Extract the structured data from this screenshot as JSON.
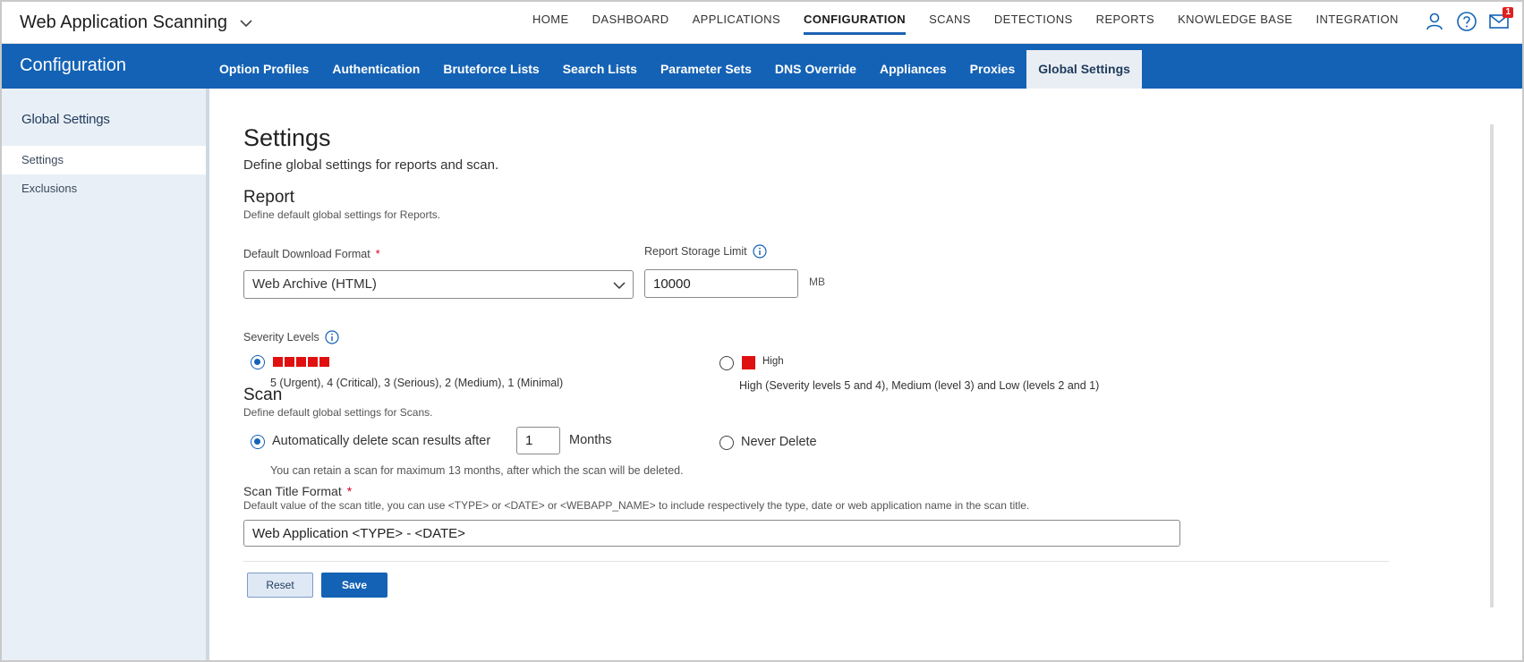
{
  "app": {
    "title": "Web Application Scanning"
  },
  "topnav": {
    "items": [
      {
        "label": "HOME"
      },
      {
        "label": "DASHBOARD"
      },
      {
        "label": "APPLICATIONS"
      },
      {
        "label": "CONFIGURATION",
        "active": true
      },
      {
        "label": "SCANS"
      },
      {
        "label": "DETECTIONS"
      },
      {
        "label": "REPORTS"
      },
      {
        "label": "KNOWLEDGE BASE"
      },
      {
        "label": "INTEGRATION"
      }
    ],
    "icons": [
      "user-icon",
      "help-icon",
      "mail-icon"
    ],
    "mail_badge": "1"
  },
  "section": {
    "title": "Configuration",
    "tabs": [
      {
        "label": "Option Profiles"
      },
      {
        "label": "Authentication"
      },
      {
        "label": "Bruteforce Lists"
      },
      {
        "label": "Search Lists"
      },
      {
        "label": "Parameter Sets"
      },
      {
        "label": "DNS Override"
      },
      {
        "label": "Appliances"
      },
      {
        "label": "Proxies"
      },
      {
        "label": "Global Settings",
        "active": true
      }
    ]
  },
  "sidebar": {
    "heading": "Global Settings",
    "items": [
      {
        "label": "Settings",
        "active": true
      },
      {
        "label": "Exclusions"
      }
    ]
  },
  "main": {
    "title": "Settings",
    "subtitle": "Define global settings for reports and scan.",
    "report": {
      "title": "Report",
      "subtitle": "Define default global settings for Reports.",
      "format_label": "Default Download Format",
      "required_mark": "*",
      "format_value": "Web Archive (HTML)",
      "storage_label": "Report Storage Limit",
      "storage_value": "10000",
      "storage_unit": "MB",
      "severity_label": "Severity Levels",
      "severity_option_1_desc": "5 (Urgent), 4 (Critical), 3 (Serious), 2 (Medium), 1 (Minimal)",
      "severity_option_2_label": "High",
      "severity_option_2_desc": "High (Severity levels 5 and 4), Medium (level 3) and Low (levels 2 and 1)",
      "severity_color": "#e01010"
    },
    "scan": {
      "title": "Scan",
      "subtitle": "Define default global settings for Scans.",
      "auto_delete_label": "Automatically delete scan results after",
      "auto_delete_value": "1",
      "auto_delete_unit": "Months",
      "never_delete_label": "Never Delete",
      "retain_note": "You can retain a scan for maximum 13 months, after which the scan will be deleted.",
      "title_format_label": "Scan Title Format",
      "title_format_help": "Default value of the scan title, you can use <TYPE> or <DATE> or <WEBAPP_NAME> to include respectively the type, date or web application name in the scan title.",
      "title_format_value": "Web Application <TYPE> - <DATE>"
    },
    "buttons": {
      "reset": "Reset",
      "save": "Save"
    }
  },
  "colors": {
    "brand_blue": "#1462b5",
    "accent_red": "#e01010"
  }
}
